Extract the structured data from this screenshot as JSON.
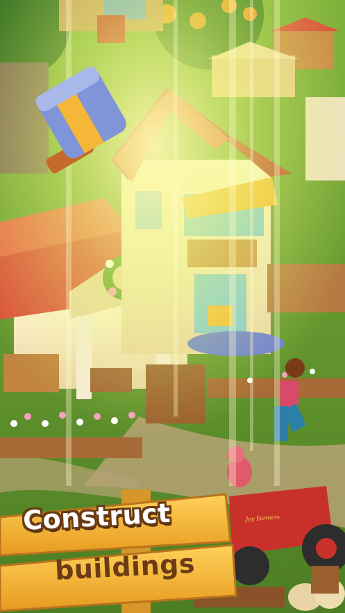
{
  "screen": {
    "title": "Construct buildings promo"
  },
  "caption": {
    "line1": "Construct",
    "line2": "buildings"
  },
  "tractor": {
    "brand_label": "Joy Farmers"
  },
  "icons": {
    "hammer": "hammer-icon"
  },
  "colors": {
    "grass": "#5e8f2c",
    "roof": "#d9503a",
    "sign_wood": "#f4b738",
    "text_outline": "#6a3b14",
    "tractor_red": "#c8312a"
  }
}
